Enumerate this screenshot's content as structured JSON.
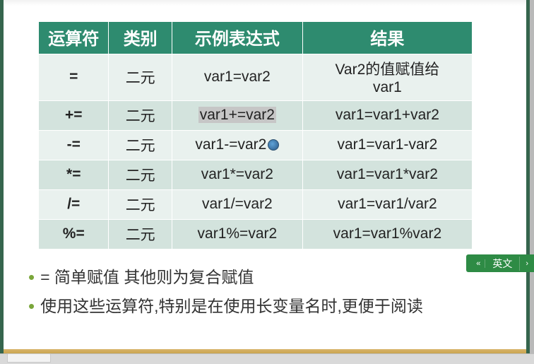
{
  "table": {
    "headers": {
      "operator": "运算符",
      "category": "类别",
      "example": "示例表达式",
      "result": "结果"
    },
    "rows": [
      {
        "op": "=",
        "cat": "二元",
        "ex": "var1=var2",
        "res": "Var2的值赋值给var1",
        "wrap": true
      },
      {
        "op": "+=",
        "cat": "二元",
        "ex": "var1+=var2",
        "res": "var1=var1+var2",
        "select": true
      },
      {
        "op": "-=",
        "cat": "二元",
        "ex": "var1-=var2",
        "res": "var1=var1-var2",
        "cursor": true
      },
      {
        "op": "*=",
        "cat": "二元",
        "ex": "var1*=var2",
        "res": "var1=var1*var2"
      },
      {
        "op": "/=",
        "cat": "二元",
        "ex": "var1/=var2",
        "res": "var1=var1/var2"
      },
      {
        "op": "%=",
        "cat": "二元",
        "ex": "var1%=var2",
        "res": "var1=var1%var2"
      }
    ]
  },
  "bullets": [
    "= 简单赋值 其他则为复合赋值",
    "使用这些运算符,特别是在使用长变量名时,更便于阅读"
  ],
  "lang": {
    "label": "英文",
    "left": "«",
    "right": "›"
  }
}
